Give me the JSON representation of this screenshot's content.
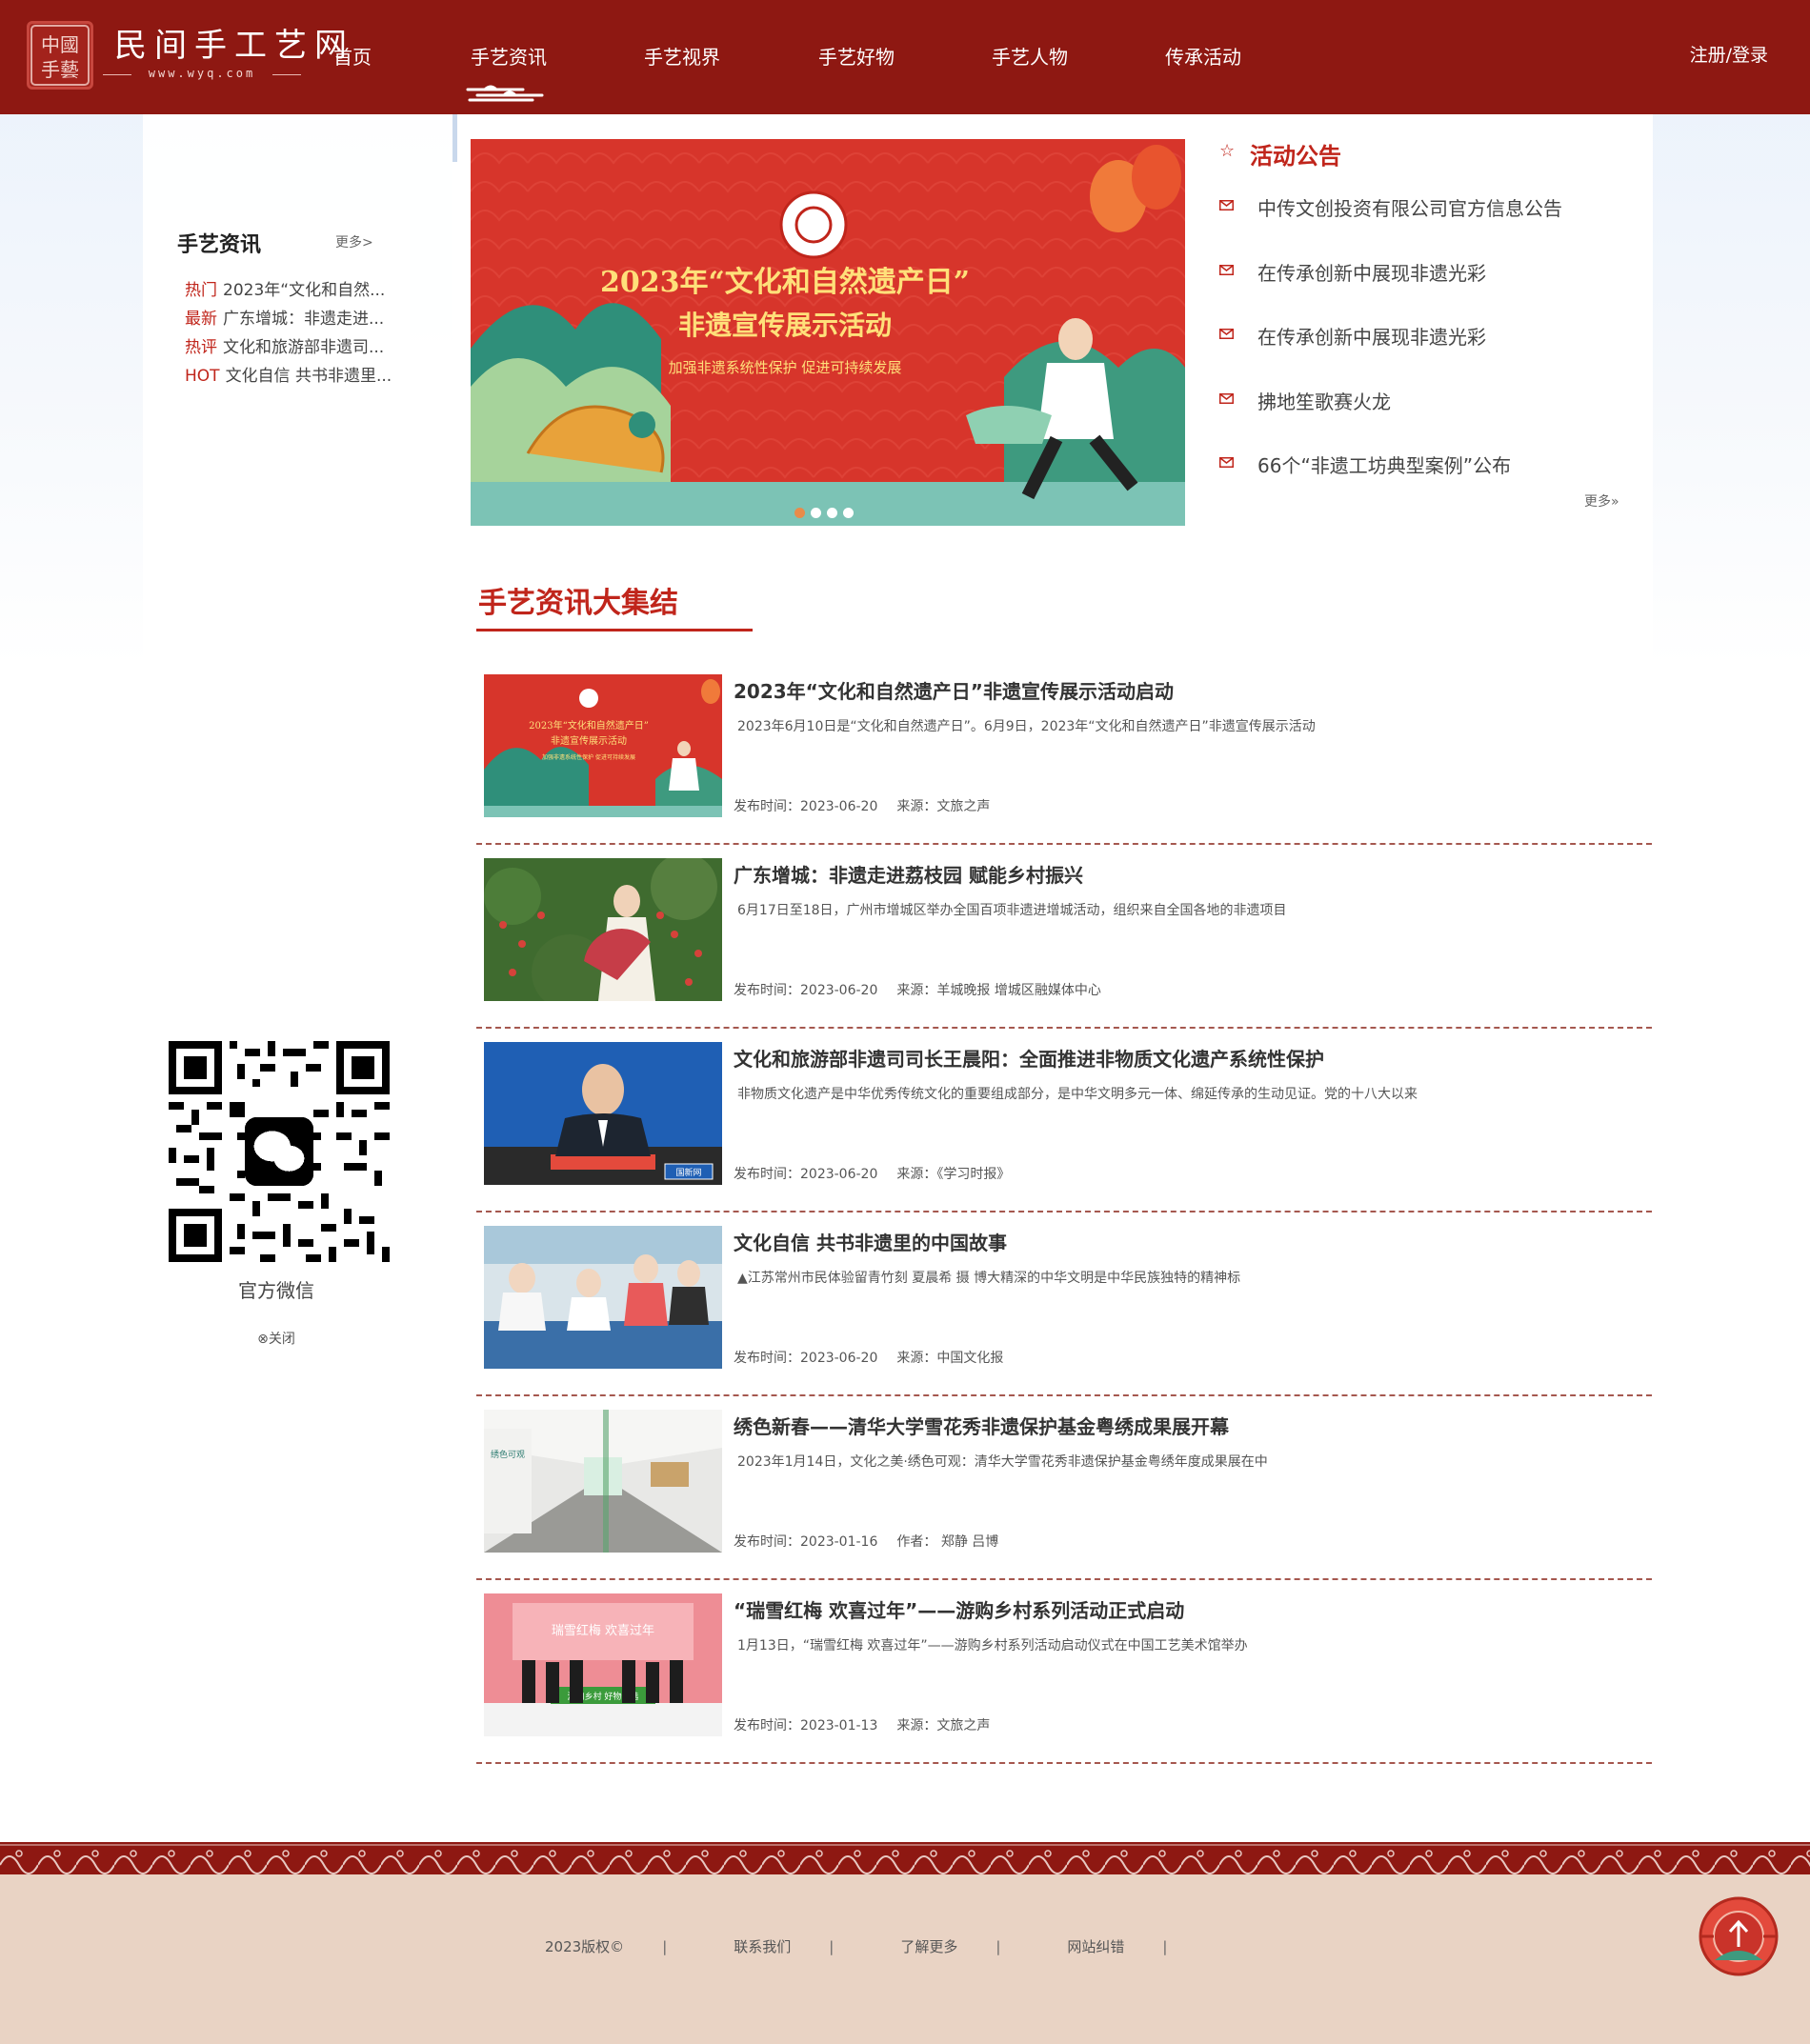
{
  "site": {
    "logo_title": "民间手工艺网",
    "logo_sub": "www.wyq.com",
    "seal_text": "中国手艺"
  },
  "nav": {
    "items": [
      "首页",
      "手艺资讯",
      "手艺视界",
      "手艺好物",
      "手艺人物",
      "传承活动"
    ],
    "active": "手艺资讯",
    "login": "注册/登录"
  },
  "sidebar": {
    "title": "手艺资讯",
    "more": "更多>",
    "items": [
      {
        "tag": "热门",
        "text": "2023年“文化和自然..."
      },
      {
        "tag": "最新",
        "text": "广东增城：非遗走进..."
      },
      {
        "tag": "热评",
        "text": "文化和旅游部非遗司..."
      },
      {
        "tag": "HOT",
        "text": "文化自信 共书非遗里..."
      }
    ],
    "qr_caption": "官方微信",
    "qr_close": "⊗关闭"
  },
  "banner": {
    "title": "2023年“文化和自然遗产日”",
    "subtitle": "非遗宣传展示活动",
    "slogan": "加强非遗系统性保护 促进可持续发展",
    "slides": 4,
    "active_slide": 1
  },
  "notice": {
    "title": "活动公告",
    "items": [
      "中传文创投资有限公司官方信息公告",
      "在传承创新中展现非遗光彩",
      "在传承创新中展现非遗光彩",
      "拂地笙歌赛火龙",
      "66个“非遗工坊典型案例”公布"
    ],
    "more": "更多»"
  },
  "section": {
    "title": "手艺资讯大集结"
  },
  "articles": [
    {
      "title": "2023年“文化和自然遗产日”非遗宣传展示活动启动",
      "summary": "2023年6月10日是“文化和自然遗产日”。6月9日，2023年“文化和自然遗产日”非遗宣传展示活动",
      "date": "发布时间：2023-06-20",
      "source": "来源：文旅之声"
    },
    {
      "title": "广东增城：非遗走进荔枝园 赋能乡村振兴",
      "summary": "6月17日至18日，广州市增城区举办全国百项非遗进增城活动，组织来自全国各地的非遗项目",
      "date": "发布时间：2023-06-20",
      "source": "来源：羊城晚报 增城区融媒体中心"
    },
    {
      "title": "文化和旅游部非遗司司长王晨阳：全面推进非物质文化遗产系统性保护",
      "summary": "非物质文化遗产是中华优秀传统文化的重要组成部分，是中华文明多元一体、绵延传承的生动见证。党的十八大以来",
      "date": "发布时间：2023-06-20",
      "source": "来源：《学习时报》"
    },
    {
      "title": "文化自信 共书非遗里的中国故事",
      "summary": "▲江苏常州市民体验留青竹刻 夏晨希 摄 博大精深的中华文明是中华民族独特的精神标",
      "date": "发布时间：2023-06-20",
      "source": "来源：中国文化报"
    },
    {
      "title": "绣色新春——清华大学雪花秀非遗保护基金粤绣成果展开幕",
      "summary": "2023年1月14日，文化之美·绣色可观：清华大学雪花秀非遗保护基金粤绣年度成果展在中",
      "date": "发布时间：2023-01-16",
      "source": "作者：  郑静 吕博"
    },
    {
      "title": "“瑞雪红梅 欢喜过年”——游购乡村系列活动正式启动",
      "summary": "1月13日，“瑞雪红梅 欢喜过年”——游购乡村系列活动启动仪式在中国工艺美术馆举办",
      "date": "发布时间：2023-01-13",
      "source": "来源：文旅之声"
    }
  ],
  "thumb_texts": {
    "news_label": "国新网",
    "exhibit_sign": "绣色可观",
    "event_sign": "瑞雪红梅 欢喜过年",
    "event_banner": "游购乡村 好物优选"
  },
  "footer": {
    "links": [
      "2023版权©",
      "联系我们",
      "了解更多",
      "网站纠错"
    ],
    "separator": "|"
  },
  "colors": {
    "brand": "#8e1812",
    "accent": "#c0251b",
    "footer_bg": "#e9d3c4"
  }
}
